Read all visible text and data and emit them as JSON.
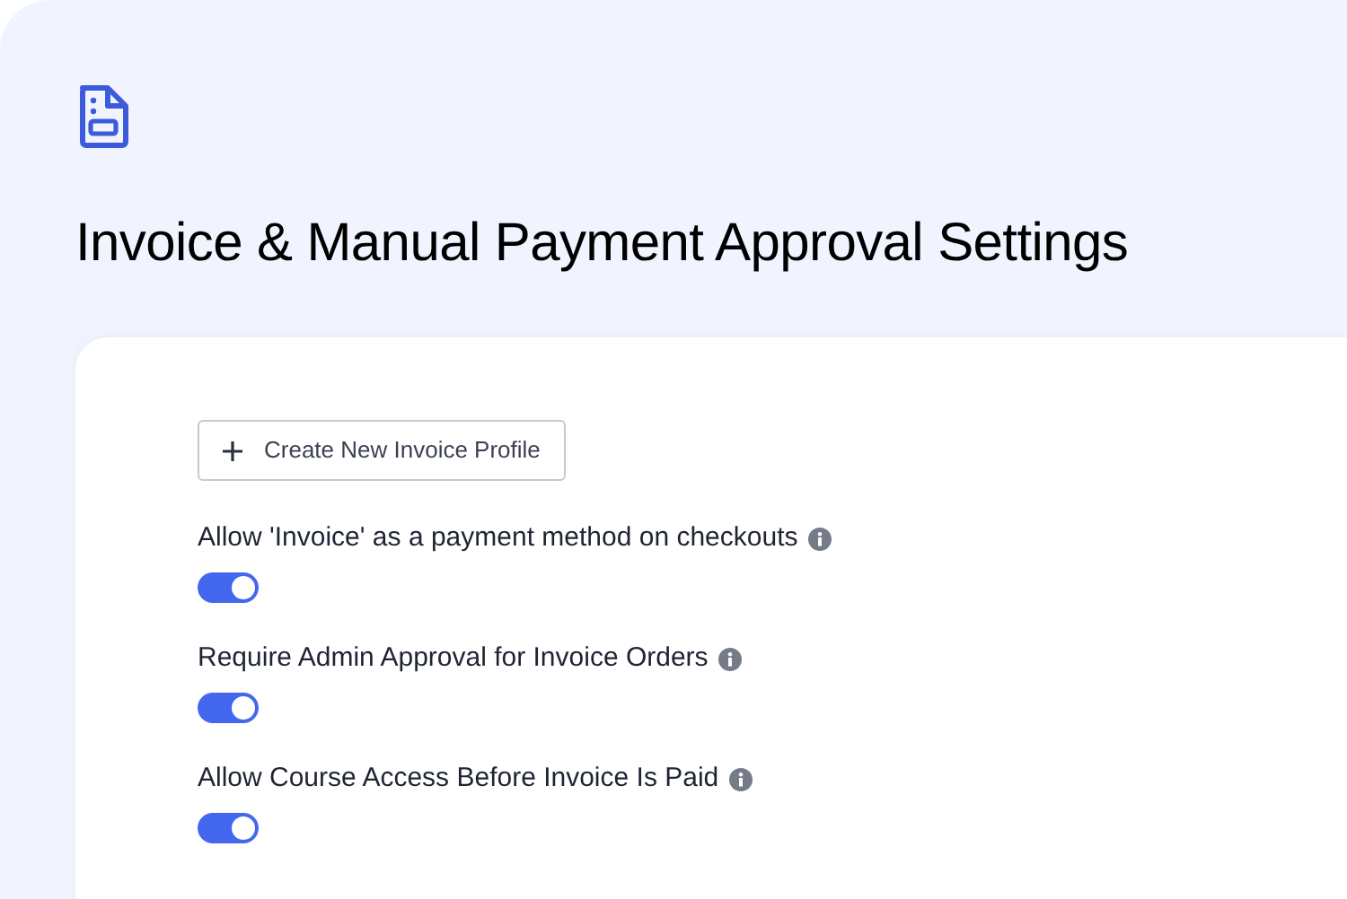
{
  "title": "Invoice & Manual Payment Approval Settings",
  "create_button": {
    "label": "Create New Invoice Profile"
  },
  "settings": [
    {
      "label": "Allow 'Invoice' as a payment method on checkouts",
      "on": true
    },
    {
      "label": "Require Admin Approval for Invoice Orders",
      "on": true
    },
    {
      "label": "Allow Course Access Before Invoice Is Paid",
      "on": true
    }
  ]
}
